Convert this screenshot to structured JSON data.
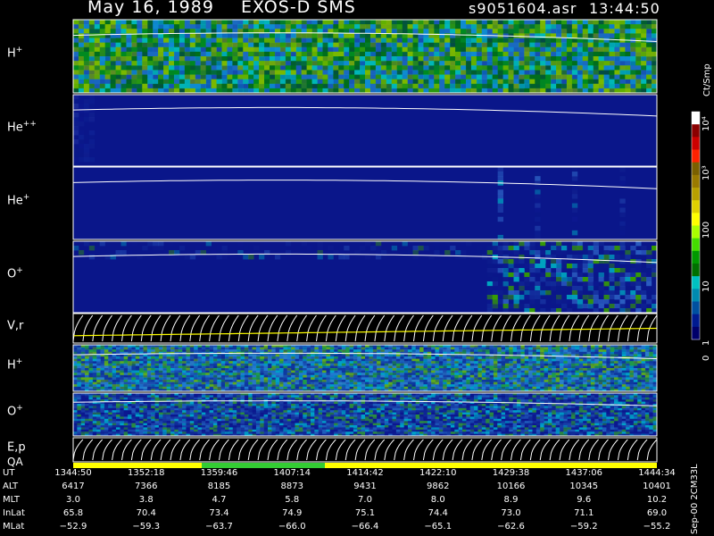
{
  "header": {
    "date": "May 16, 1989",
    "title": "EXOS-D SMS",
    "filename": "s9051604.asr",
    "time": "13:44:50"
  },
  "panels": [
    {
      "id": "hplus",
      "label": "H",
      "sup": "+",
      "ymax": "180",
      "ymin": "−180",
      "kind": "spec",
      "palette": "green"
    },
    {
      "id": "he2",
      "label": "He",
      "sup": "++",
      "ymax": "180",
      "ymin": "−180",
      "kind": "spec",
      "palette": "navy"
    },
    {
      "id": "heplus",
      "label": "He",
      "sup": "+",
      "ymax": "180",
      "ymin": "−180",
      "kind": "spec",
      "palette": "navy_cyan"
    },
    {
      "id": "oplus",
      "label": "O",
      "sup": "+",
      "ymax": "180",
      "ymin": "−180",
      "kind": "spec",
      "palette": "navy_green"
    },
    {
      "id": "vr",
      "label": "V,r",
      "sup": "",
      "ymax": "25",
      "ymin": "0",
      "kind": "line",
      "right_top": "90",
      "right_bottom": "0"
    },
    {
      "id": "hplus2",
      "label": "H",
      "sup": "+",
      "ymax": "180",
      "ymin": "−180",
      "kind": "spec",
      "palette": "mixed"
    },
    {
      "id": "oplus2",
      "label": "O",
      "sup": "+",
      "ymax": "180",
      "ymin": "−180",
      "kind": "spec",
      "palette": "mixed_navy"
    },
    {
      "id": "ep",
      "label": "E,p",
      "sup": "",
      "ymax": "4000",
      "ymin": "0",
      "kind": "line",
      "right_top": "90",
      "right_bottom": "0"
    }
  ],
  "qa_label": "QA",
  "colorbar": {
    "unit": "Ct/Smp",
    "ticks": [
      "10⁴",
      "10³",
      "100",
      "10",
      "1",
      "0"
    ],
    "colors": [
      "#ffffff",
      "#8b0000",
      "#cc0000",
      "#ff2200",
      "#7a6000",
      "#9a7a00",
      "#b8a000",
      "#e0d000",
      "#ffff00",
      "#aaff00",
      "#44dd00",
      "#009900",
      "#007000",
      "#00c0c0",
      "#008ab0",
      "#0050a0",
      "#001a90",
      "#00006a"
    ]
  },
  "chart_data": {
    "type": "heatmap",
    "rows": [
      {
        "name": "UT",
        "values": [
          "1344:50",
          "1352:18",
          "1359:46",
          "1407:14",
          "1414:42",
          "1422:10",
          "1429:38",
          "1437:06",
          "1444:34"
        ]
      },
      {
        "name": "ALT",
        "values": [
          "6417",
          "7366",
          "8185",
          "8873",
          "9431",
          "9862",
          "10166",
          "10345",
          "10401"
        ]
      },
      {
        "name": "MLT",
        "values": [
          "3.0",
          "3.8",
          "4.7",
          "5.8",
          "7.0",
          "8.0",
          "8.9",
          "9.6",
          "10.2"
        ]
      },
      {
        "name": "InLat",
        "values": [
          "65.8",
          "70.4",
          "73.4",
          "74.9",
          "75.1",
          "74.4",
          "73.0",
          "71.1",
          "69.0"
        ]
      },
      {
        "name": "MLat",
        "values": [
          "−52.9",
          "−59.3",
          "−63.7",
          "−66.0",
          "−66.4",
          "−65.1",
          "−62.6",
          "−59.2",
          "−55.2"
        ]
      }
    ],
    "footer_note": "Sep-00  2CM33L"
  }
}
